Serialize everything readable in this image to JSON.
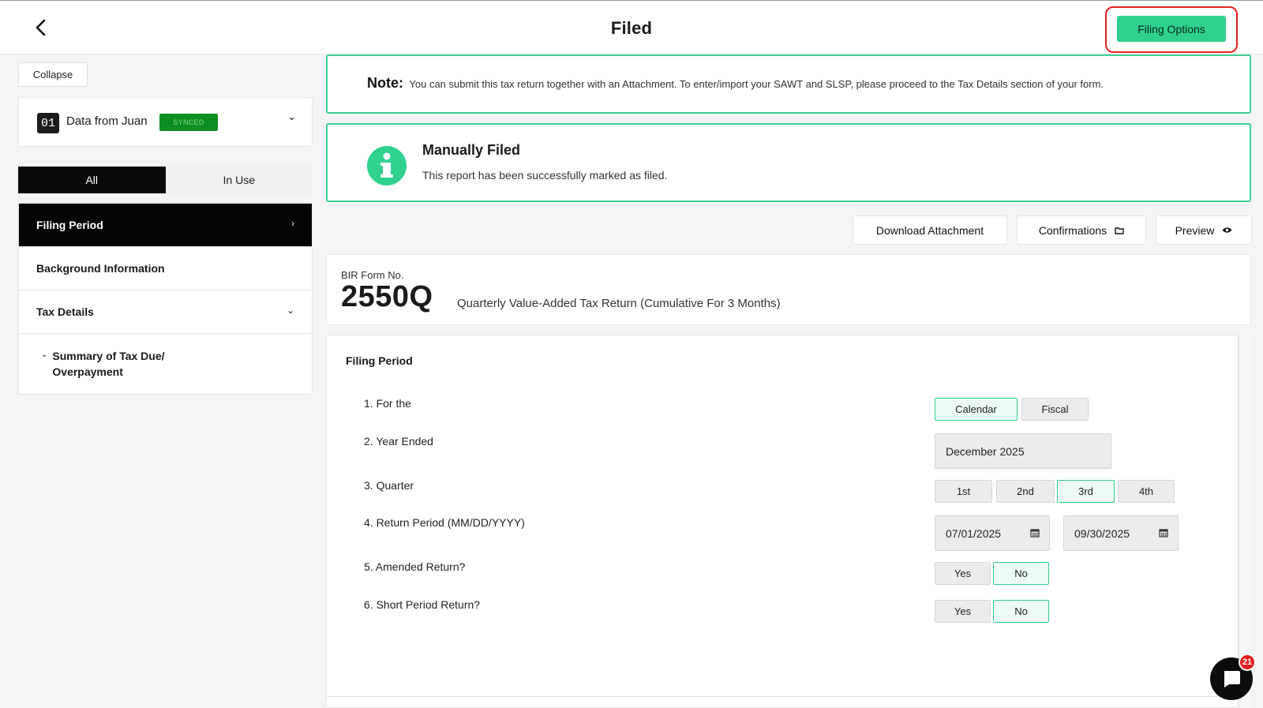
{
  "header": {
    "title": "Filed",
    "filing_options_label": "Filing Options"
  },
  "sidebar": {
    "collapse_label": "Collapse",
    "data_source": {
      "number": "01",
      "label": "Data from Juan",
      "badge": "SYNCED"
    },
    "tabs": [
      {
        "label": "All",
        "active": true
      },
      {
        "label": "In Use",
        "active": false
      }
    ],
    "nav": [
      {
        "label": "Filing Period",
        "active": true
      },
      {
        "label": "Background Information"
      },
      {
        "label": "Tax Details"
      },
      {
        "label": "Summary of Tax Due/ Overpayment",
        "line1": "Summary of Tax Due/",
        "line2": "Overpayment"
      }
    ]
  },
  "note": {
    "prefix": "Note:",
    "text": "You can submit this tax return together with an Attachment. To enter/import your SAWT and SLSP, please proceed to the Tax Details section of your form."
  },
  "status": {
    "title": "Manually Filed",
    "message": "This report has been successfully marked as filed."
  },
  "actions": {
    "download_attachment": "Download Attachment",
    "confirmations": "Confirmations",
    "preview": "Preview"
  },
  "form": {
    "label": "BIR Form No.",
    "number": "2550Q",
    "description": "Quarterly Value-Added Tax Return (Cumulative For 3 Months)"
  },
  "filing_period": {
    "title": "Filing Period",
    "q1": {
      "label": "1. For the",
      "options": [
        "Calendar",
        "Fiscal"
      ],
      "selected": "Calendar"
    },
    "q2": {
      "label": "2. Year Ended",
      "value": "December 2025"
    },
    "q3": {
      "label": "3. Quarter",
      "options": [
        "1st",
        "2nd",
        "3rd",
        "4th"
      ],
      "selected": "3rd"
    },
    "q4": {
      "label": "4. Return Period (MM/DD/YYYY)",
      "from": "07/01/2025",
      "to": "09/30/2025"
    },
    "q5": {
      "label": "5. Amended Return?",
      "options": [
        "Yes",
        "No"
      ],
      "selected": "No"
    },
    "q6": {
      "label": "6. Short Period Return?",
      "options": [
        "Yes",
        "No"
      ],
      "selected": "No"
    }
  },
  "chat": {
    "badge_count": "21"
  },
  "colors": {
    "accent": "#2fd18c",
    "highlight": "#e02020",
    "badge": "#e51f1f",
    "synced": "#0d8f1f"
  }
}
